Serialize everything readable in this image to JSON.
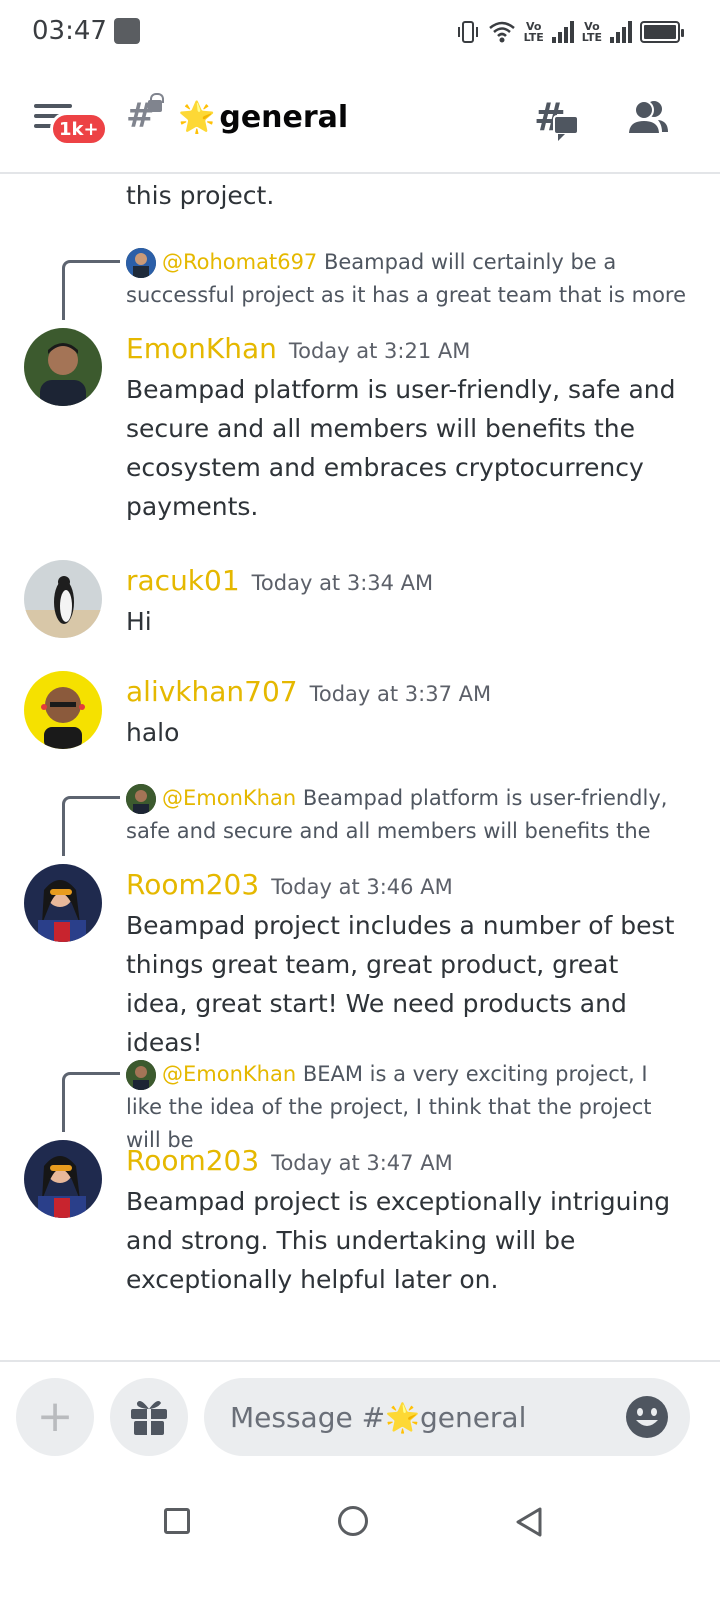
{
  "status_bar": {
    "time": "03:47",
    "net1": "Vo\nLTE",
    "net2": "Vo\nLTE"
  },
  "header": {
    "badge": "1k+",
    "channel_name": "general",
    "channel_emoji": "🌟",
    "hash": "#"
  },
  "chat": {
    "top_fragment": "this project.",
    "messages": [
      {
        "reply_to": "@Rohomat697",
        "reply_text": "Beampad will certainly be a successful project as it has a great team that is more",
        "author": "EmonKhan",
        "time": "Today at 3:21 AM",
        "text": "Beampad platform is user-friendly, safe and secure and all members will benefits the ecosystem and embraces cryptocurrency payments."
      },
      {
        "author": "racuk01",
        "time": "Today at 3:34 AM",
        "text": "Hi"
      },
      {
        "author": "alivkhan707",
        "time": "Today at 3:37 AM",
        "text": "halo"
      },
      {
        "reply_to": "@EmonKhan",
        "reply_text": "Beampad platform is user-friendly, safe and secure and all members will benefits the",
        "author": "Room203",
        "time": "Today at 3:46 AM",
        "text": "Beampad project includes a number of best things great team, great product, great idea, great start! We need products and ideas!"
      },
      {
        "reply_to": "@EmonKhan",
        "reply_text": "BEAM is a very exciting project, I like the idea of the project, I think that the project will be",
        "author": "Room203",
        "time": "Today at 3:47 AM",
        "text": "Beampad project is exceptionally intriguing and strong. This undertaking will be exceptionally helpful later on."
      }
    ]
  },
  "composer": {
    "placeholder": "Message #🌟general"
  },
  "colors": {
    "username": "#e5b800",
    "badge": "#ed4245"
  },
  "icons": {
    "menu": "menu-icon",
    "threads": "threads-icon",
    "members": "members-icon",
    "add": "plus-icon",
    "gift": "gift-icon",
    "emoji": "emoji-icon"
  }
}
